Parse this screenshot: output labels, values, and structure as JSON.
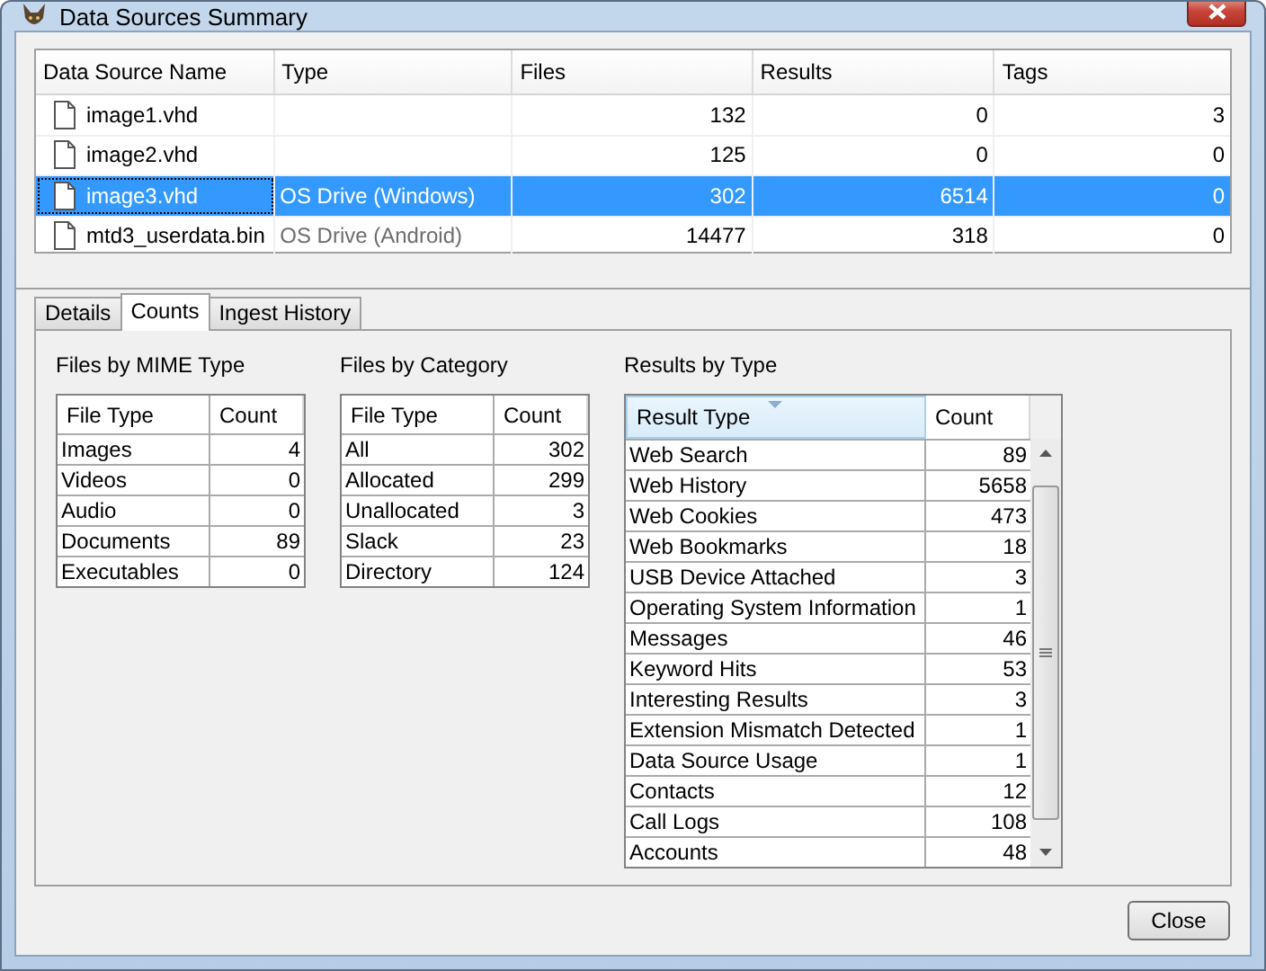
{
  "window": {
    "title": "Data Sources Summary"
  },
  "data_sources": {
    "columns": [
      "Data Source Name",
      "Type",
      "Files",
      "Results",
      "Tags"
    ],
    "rows": [
      {
        "name": "image1.vhd",
        "type": "",
        "files": "132",
        "results": "0",
        "tags": "3",
        "selected": false
      },
      {
        "name": "image2.vhd",
        "type": "",
        "files": "125",
        "results": "0",
        "tags": "0",
        "selected": false
      },
      {
        "name": "image3.vhd",
        "type": "OS Drive (Windows)",
        "files": "302",
        "results": "6514",
        "tags": "0",
        "selected": true
      },
      {
        "name": "mtd3_userdata.bin",
        "type": "OS Drive (Android)",
        "files": "14477",
        "results": "318",
        "tags": "0",
        "selected": false
      }
    ]
  },
  "tabs": [
    {
      "label": "Details",
      "selected": false
    },
    {
      "label": "Counts",
      "selected": true
    },
    {
      "label": "Ingest History",
      "selected": false
    }
  ],
  "counts": [
    {
      "title": "Files by MIME Type",
      "columns": [
        "File Type",
        "Count"
      ],
      "rows": [
        [
          "Images",
          "4"
        ],
        [
          "Videos",
          "0"
        ],
        [
          "Audio",
          "0"
        ],
        [
          "Documents",
          "89"
        ],
        [
          "Executables",
          "0"
        ]
      ]
    },
    {
      "title": "Files by Category",
      "columns": [
        "File Type",
        "Count"
      ],
      "rows": [
        [
          "All",
          "302"
        ],
        [
          "Allocated",
          "299"
        ],
        [
          "Unallocated",
          "3"
        ],
        [
          "Slack",
          "23"
        ],
        [
          "Directory",
          "124"
        ]
      ]
    },
    {
      "title": "Results by Type",
      "columns": [
        "Result Type",
        "Count"
      ],
      "sorted": true,
      "rows": [
        [
          "Web Search",
          "89"
        ],
        [
          "Web History",
          "5658"
        ],
        [
          "Web Cookies",
          "473"
        ],
        [
          "Web Bookmarks",
          "18"
        ],
        [
          "USB Device Attached",
          "3"
        ],
        [
          "Operating System Information",
          "1"
        ],
        [
          "Messages",
          "46"
        ],
        [
          "Keyword Hits",
          "53"
        ],
        [
          "Interesting Results",
          "3"
        ],
        [
          "Extension Mismatch Detected",
          "1"
        ],
        [
          "Data Source Usage",
          "1"
        ],
        [
          "Contacts",
          "12"
        ],
        [
          "Call Logs",
          "108"
        ],
        [
          "Accounts",
          "48"
        ]
      ]
    }
  ],
  "buttons": [
    "Close"
  ]
}
